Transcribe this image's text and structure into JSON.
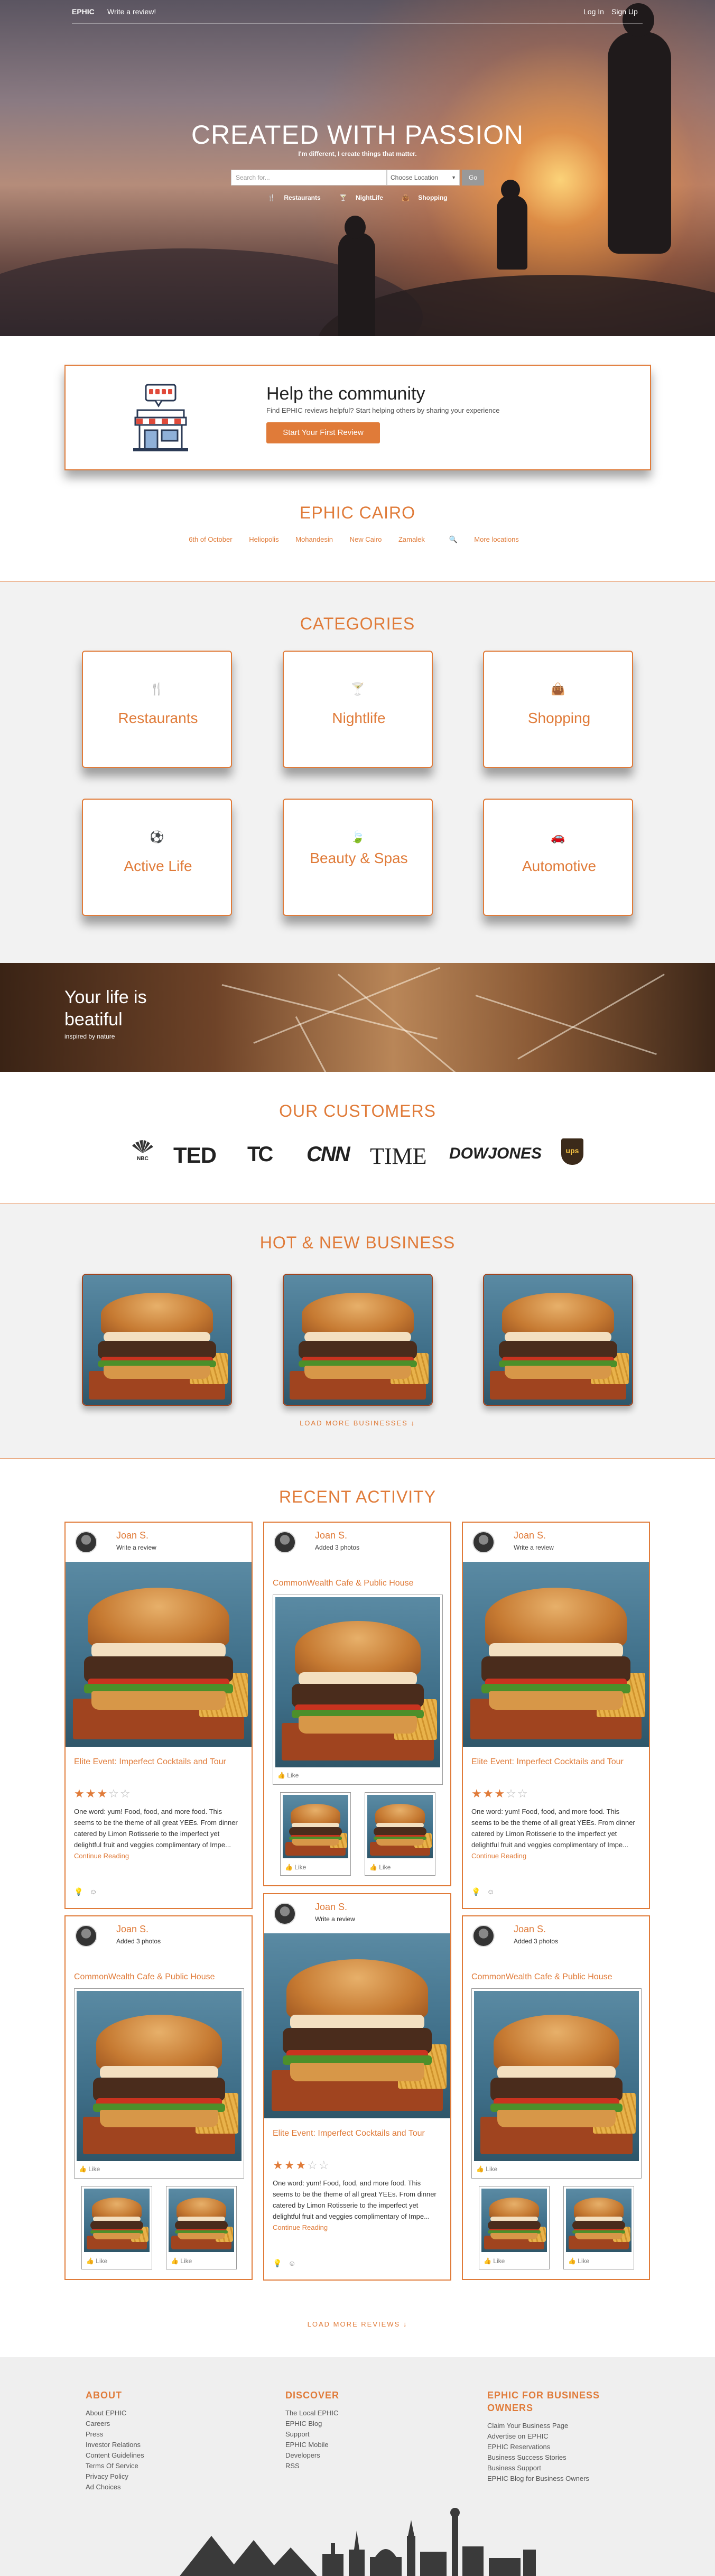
{
  "nav": {
    "logo": "EPHIC",
    "write": "Write a review!",
    "login": "Log In",
    "signup": "Sign Up"
  },
  "hero": {
    "title": "CREATED WITH PASSION",
    "subtitle": "I'm different, I create things that matter.",
    "search_placeholder": "Search for...",
    "location_value": "Choose Location",
    "go_label": "Go",
    "quick_links": [
      "Restaurants",
      "NightLife",
      "Shopping"
    ]
  },
  "help": {
    "title": "Help the community",
    "text": "Find EPHIC reviews helpful? Start helping others by sharing your experience",
    "button": "Start Your First Review"
  },
  "city": {
    "title": "EPHIC CAIRO",
    "areas": [
      "6th of October",
      "Heliopolis",
      "Mohandesin",
      "New Cairo",
      "Zamalek"
    ],
    "more": "More locations"
  },
  "categories": {
    "title": "CATEGORIES",
    "items": [
      {
        "label": "Restaurants",
        "icon": "utensils-icon"
      },
      {
        "label": "Nightlife",
        "icon": "cocktail-icon"
      },
      {
        "label": "Shopping",
        "icon": "shopping-bag-icon"
      },
      {
        "label": "Active Life",
        "icon": "soccer-ball-icon"
      },
      {
        "label": "Beauty & Spas",
        "icon": "leaf-icon"
      },
      {
        "label": "Automotive",
        "icon": "car-icon"
      }
    ]
  },
  "banner": {
    "title_line1": "Your life is",
    "title_line2": "beatiful",
    "byline": "inspired by nature"
  },
  "customers": {
    "title": "OUR CUSTOMERS",
    "logos": [
      "NBC",
      "TED",
      "TC",
      "CNN",
      "TIME",
      "DOWJONES",
      "ups"
    ]
  },
  "hot": {
    "title": "HOT & NEW BUSINESS",
    "more": "LOAD MORE BUSINESSES"
  },
  "activity": {
    "title": "RECENT ACTIVITY",
    "user": "Joan S.",
    "action_review": "Write a review",
    "action_photos": "Added 3 photos",
    "business": "CommonWealth Cafe & Public House",
    "event_title": "Elite Event: Imperfect Cocktails and Tour",
    "rating": 3,
    "review_text": "One word: yum! Food, food, and more food. This seems to be the theme of all great YEEs. From dinner catered by Limon Rotisserie to the imperfect yet delightful fruit and veggies complimentary of Impe...",
    "read_more": "Continue Reading",
    "like": "Like",
    "more": "LOAD MORE REVIEWS"
  },
  "footer": {
    "about": {
      "title": "ABOUT",
      "links": [
        "About EPHIC",
        "Careers",
        "Press",
        "Investor Relations",
        "Content Guidelines",
        "Terms Of Service",
        "Privacy Policy",
        "Ad Choices"
      ]
    },
    "discover": {
      "title": "DISCOVER",
      "links": [
        "The Local EPHIC",
        "EPHIC Blog",
        "Support",
        "EPHIC Mobile",
        "Developers",
        "RSS"
      ]
    },
    "business": {
      "title": "EPHIC FOR BUSINESS OWNERS",
      "links": [
        "Claim Your Business Page",
        "Advertise on EPHIC",
        "EPHIC Reservations",
        "Business Success Stories",
        "Business Support",
        "EPHIC Blog for Business Owners"
      ]
    }
  },
  "colors": {
    "accent": "#e07b39",
    "dark_accent": "#a0441f",
    "section_gray": "#f2f2f2"
  }
}
